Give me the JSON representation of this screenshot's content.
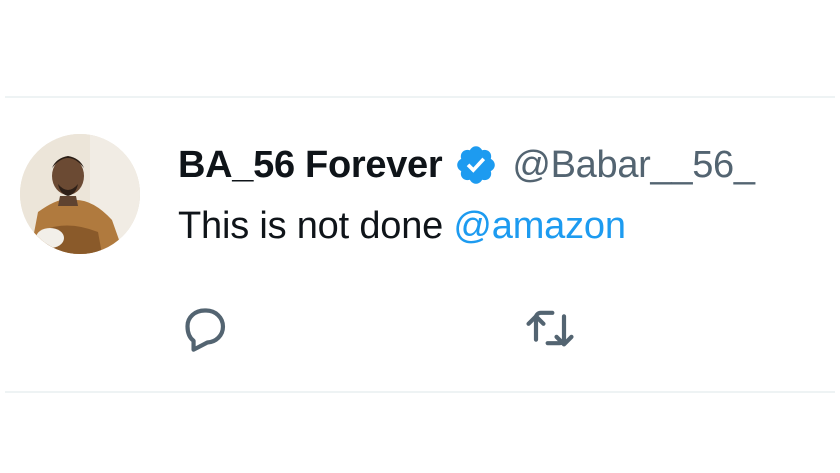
{
  "tweet": {
    "display_name": "BA_56 Forever",
    "handle": "@Babar__56_",
    "text": "This is not done ",
    "mention": "@amazon"
  },
  "icons": {
    "verified": "verified-badge-icon",
    "reply": "reply-icon",
    "retweet": "retweet-icon"
  },
  "colors": {
    "text": "#0f1419",
    "secondary": "#536471",
    "accent": "#1d9bf0",
    "divider": "#eef3f4"
  }
}
